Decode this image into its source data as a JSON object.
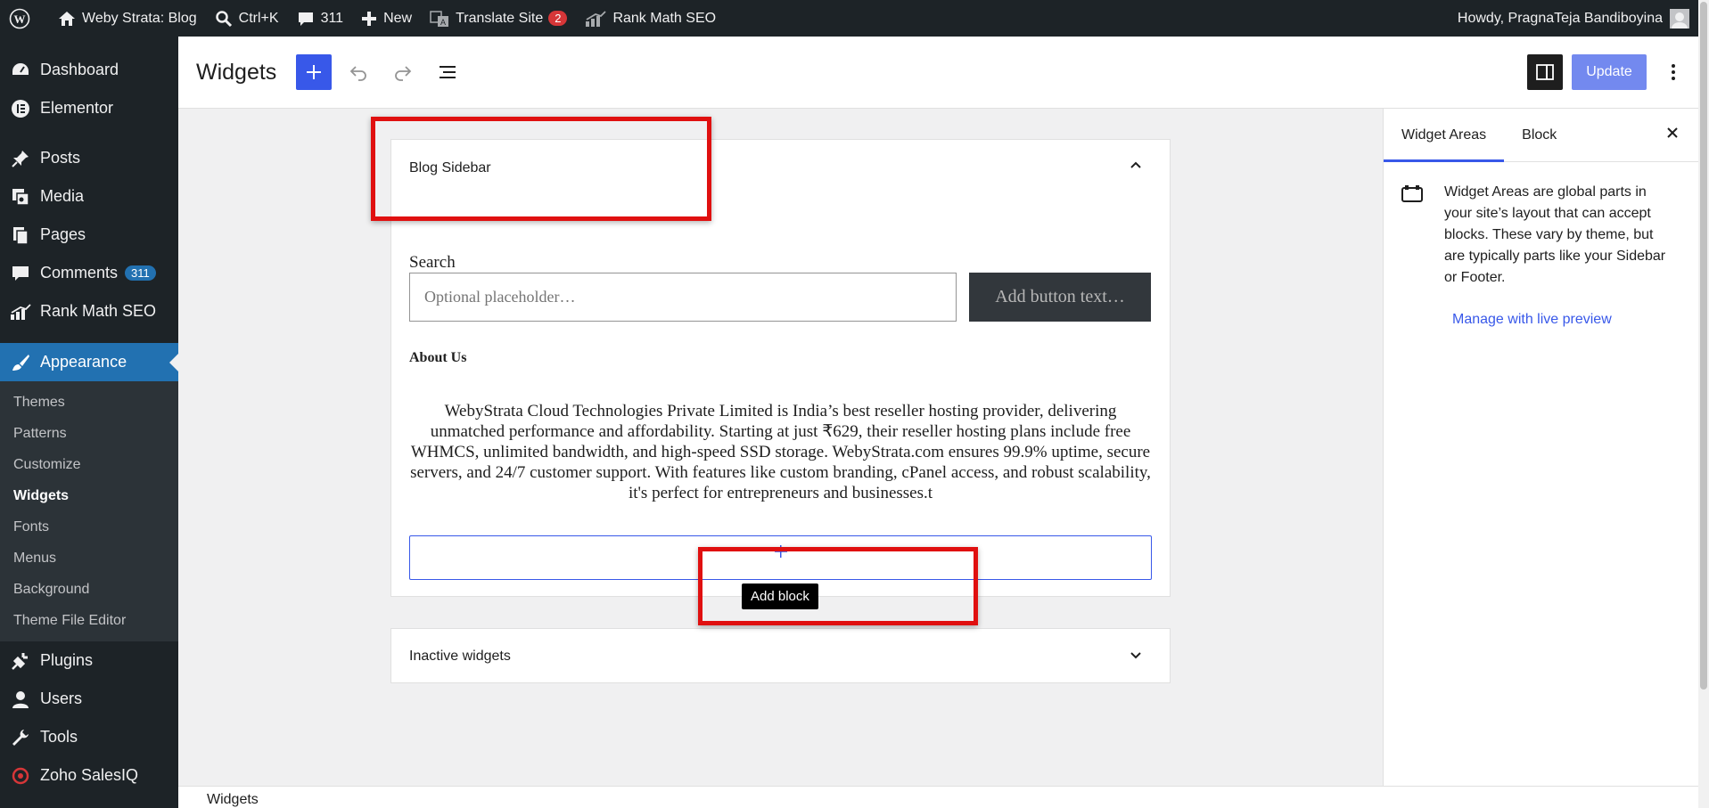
{
  "admin_bar": {
    "site_name": "Weby Strata: Blog",
    "search_shortcut": "Ctrl+K",
    "comments_count": "311",
    "new_label": "New",
    "translate_label": "Translate Site",
    "translate_badge": "2",
    "rank_math_label": "Rank Math SEO",
    "howdy": "Howdy, PragnaTeja Bandiboyina"
  },
  "admin_menu": {
    "dashboard": "Dashboard",
    "elementor": "Elementor",
    "posts": "Posts",
    "media": "Media",
    "pages": "Pages",
    "comments": "Comments",
    "comments_badge": "311",
    "rank_math": "Rank Math SEO",
    "appearance": "Appearance",
    "submenu": {
      "themes": "Themes",
      "patterns": "Patterns",
      "customize": "Customize",
      "widgets": "Widgets",
      "fonts": "Fonts",
      "menus": "Menus",
      "background": "Background",
      "theme_file_editor": "Theme File Editor"
    },
    "plugins": "Plugins",
    "users": "Users",
    "tools": "Tools",
    "zoho": "Zoho SalesIQ"
  },
  "header": {
    "title": "Widgets",
    "update_label": "Update"
  },
  "canvas": {
    "blog_sidebar_title": "Blog Sidebar",
    "search_label": "Search",
    "search_placeholder": "Optional placeholder…",
    "search_button_placeholder": "Add button text…",
    "about_heading": "About Us",
    "about_text": "WebyStrata Cloud Technologies Private Limited is India’s best reseller hosting provider, delivering unmatched performance and affordability. Starting at just ₹629, their reseller hosting plans include free WHMCS, unlimited bandwidth, and high-speed SSD storage. WebyStrata.com ensures 99.9% uptime, secure servers, and 24/7 customer support. With features like custom branding, cPanel access, and robust scalability, it's perfect for entrepreneurs and businesses.t",
    "add_block_tooltip": "Add block",
    "inactive_widgets_title": "Inactive widgets"
  },
  "settings_sidebar": {
    "tab_widget_areas": "Widget Areas",
    "tab_block": "Block",
    "description": "Widget Areas are global parts in your site’s layout that can accept blocks. These vary by theme, but are typically parts like your Sidebar or Footer.",
    "manage_link": "Manage with live preview"
  },
  "footer": {
    "breadcrumb": "Widgets"
  },
  "colors": {
    "accent": "#3858e9",
    "admin_bg": "#1d2327",
    "menu_active": "#2271b1",
    "annotation_red": "#e01010"
  }
}
